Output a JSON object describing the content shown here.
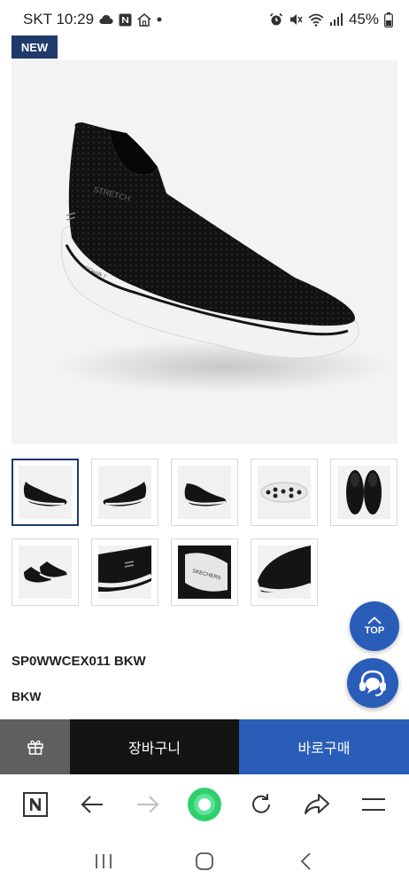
{
  "status_bar": {
    "carrier_time": "SKT 10:29",
    "battery": "45%"
  },
  "product": {
    "badge": "NEW",
    "code": "SP0WWCEX011 BKW",
    "color": "BKW",
    "shoe_color": "#141414",
    "sole_color": "#f2f2f2"
  },
  "thumbnails": [
    {
      "view": "side-left",
      "selected": true
    },
    {
      "view": "side-right",
      "selected": false
    },
    {
      "view": "side-angle",
      "selected": false
    },
    {
      "view": "sole-bottom",
      "selected": false
    },
    {
      "view": "top-pair",
      "selected": false
    },
    {
      "view": "pair-angle",
      "selected": false
    },
    {
      "view": "heel-closeup",
      "selected": false
    },
    {
      "view": "insole-closeup",
      "selected": false
    },
    {
      "view": "toe-closeup",
      "selected": false
    }
  ],
  "floating": {
    "top_label": "TOP"
  },
  "actions": {
    "cart_label": "장바구니",
    "buy_label": "바로구매"
  },
  "colors": {
    "navy": "#1f3a6b",
    "accent_blue": "#2a5db8",
    "dark": "#141414",
    "gray": "#5f5f5f",
    "browser_green": "#2fd06b"
  }
}
